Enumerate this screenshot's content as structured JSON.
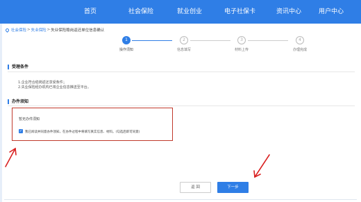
{
  "nav": {
    "items": [
      "首页",
      "社会保险",
      "就业创业",
      "电子社保卡",
      "资讯中心",
      "用户中心"
    ]
  },
  "breadcrumb": {
    "links": [
      "社会保险",
      "失业保险"
    ],
    "separator": ">",
    "current": "失业保险稳岗返还单位信息确认"
  },
  "steps": [
    {
      "number": "1",
      "label": "操作须知",
      "state": "active"
    },
    {
      "number": "2",
      "label": "信息填写",
      "state": "todo"
    },
    {
      "number": "3",
      "label": "材料上传",
      "state": "todo"
    },
    {
      "number": "4",
      "label": "办理完成",
      "state": "todo"
    }
  ],
  "sections": {
    "conditions_title": "受理条件",
    "conditions": [
      "1.企业符合稳岗返还享受条件；",
      "2.失业保险经办机构已将企业信息推送至平台。"
    ],
    "notice_title": "办件须知",
    "notice_empty": "暂无办件须知",
    "agree_text": "我已阅读并同意办件须知，在办件过程中将填写真实信息、材料。(勾选后即可同意)",
    "agree_checked": true
  },
  "buttons": {
    "back": "返 回",
    "next": "下一步"
  },
  "colors": {
    "primary": "#2f7ee6",
    "highlight": "#c0392b"
  }
}
